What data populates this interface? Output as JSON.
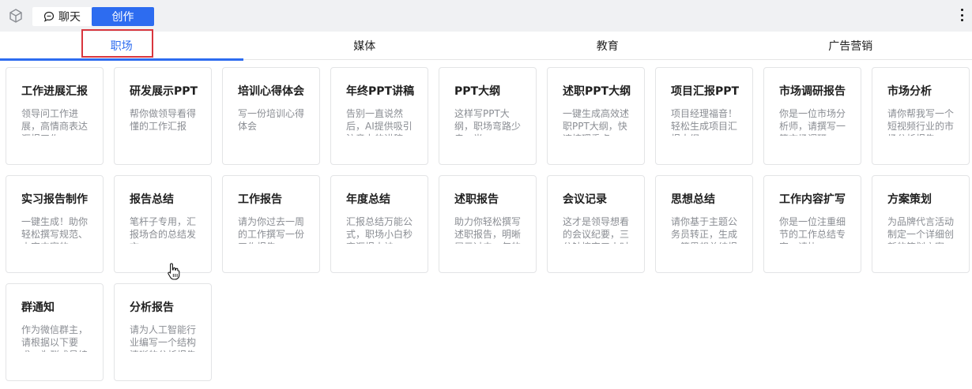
{
  "header": {
    "mode_chat": "聊天",
    "mode_create": "创作"
  },
  "tabs": [
    "职场",
    "媒体",
    "教育",
    "广告营销"
  ],
  "cards": [
    {
      "title": "工作进展汇报",
      "desc": "领导问工作进展，高情商表达汇报工作"
    },
    {
      "title": "研发展示PPT",
      "desc": "帮你做领导看得懂的工作汇报"
    },
    {
      "title": "培训心得体会",
      "desc": "写一份培训心得体会"
    },
    {
      "title": "年终PPT讲稿",
      "desc": "告别一直说然后，AI提供吸引注意力的讲稿"
    },
    {
      "title": "PPT大纲",
      "desc": "这样写PPT大纲，职场弯路少走一半"
    },
    {
      "title": "述职PPT大纲",
      "desc": "一键生成高效述职PPT大纲，快速梳理重点"
    },
    {
      "title": "项目汇报PPT",
      "desc": "项目经理福音！轻松生成项目汇报大纲"
    },
    {
      "title": "市场调研报告",
      "desc": "你是一位市场分析师，请撰写一篇市场调研"
    },
    {
      "title": "市场分析",
      "desc": "请你帮我写一个短视频行业的市场分析报告"
    },
    {
      "title": "实习报告制作",
      "desc": "一键生成！助你轻松撰写规范、内容丰富的"
    },
    {
      "title": "报告总结",
      "desc": "笔杆子专用，汇报场合的总结发言"
    },
    {
      "title": "工作报告",
      "desc": "请为你过去一周的工作撰写一份工作报告"
    },
    {
      "title": "年度总结",
      "desc": "汇报总结万能公式，职场小白秒变汇报大神"
    },
    {
      "title": "述职报告",
      "desc": "助力你轻松撰写述职报告，明晰展示过去一年的绩效亮点"
    },
    {
      "title": "会议记录",
      "desc": "这才是领导想看的会议纪要，三分钟搞定三小时的会"
    },
    {
      "title": "思想总结",
      "desc": "请你基于主题公务员转正，生成一篇思想总结报告"
    },
    {
      "title": "工作内容扩写",
      "desc": "你是一位注重细节的工作总结专家，请协"
    },
    {
      "title": "方案策划",
      "desc": "为品牌代言活动制定一个详细创新的策划方案"
    },
    {
      "title": "群通知",
      "desc": "作为微信群主，请根据以下要求，为群成员编写一条"
    },
    {
      "title": "分析报告",
      "desc": "请为人工智能行业编写一个结构清晰的分析报告"
    }
  ],
  "colors": {
    "accent": "#2d6cf0",
    "highlight_border": "#d9363e",
    "topbar_bg": "#f0f1f3"
  },
  "icons": {
    "logo": "cube-icon",
    "chat": "chat-bubble-icon",
    "more": "more-vertical-icon",
    "cursor": "hand-pointer-icon"
  }
}
